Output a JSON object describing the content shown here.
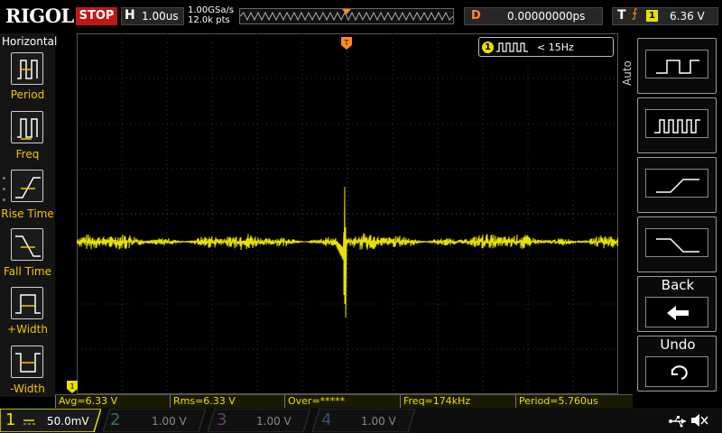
{
  "brand": "RIGOL",
  "run_state": "STOP",
  "horizontal": {
    "label": "H",
    "timebase": "1.00us",
    "sample_rate": "1.00GSa/s",
    "points": "12.0k pts"
  },
  "delay": {
    "label": "D",
    "value": "0.00000000ps"
  },
  "trigger": {
    "label": "T",
    "channel": "1",
    "level": "6.36 V",
    "marker": "T"
  },
  "freq_counter": {
    "channel": "1",
    "value": "< 15Hz"
  },
  "left_menu": {
    "title": "Horizontal",
    "items": [
      {
        "label": "Period"
      },
      {
        "label": "Freq"
      },
      {
        "label": "Rise Time"
      },
      {
        "label": "Fall Time"
      },
      {
        "label": "+Width"
      },
      {
        "label": "-Width"
      }
    ]
  },
  "right_menu": {
    "auto_label": "Auto",
    "back_label": "Back",
    "undo_label": "Undo"
  },
  "measurements": [
    {
      "text": "Avg=6.33 V"
    },
    {
      "text": "Rms=6.33 V"
    },
    {
      "text": "Over=*****"
    },
    {
      "text": "Freq=174kHz"
    },
    {
      "text": "Period=5.760us"
    }
  ],
  "channels": [
    {
      "num": "1",
      "scale": "50.0mV",
      "color": "#e8e000"
    },
    {
      "num": "2",
      "scale": "1.00 V",
      "color": "#00c8c8"
    },
    {
      "num": "3",
      "scale": "1.00 V",
      "color": "#e040e0"
    },
    {
      "num": "4",
      "scale": "1.00 V",
      "color": "#4080ff"
    }
  ],
  "colors": {
    "ch1": "#e8e000",
    "trigger": "#ff8c1a",
    "stop": "#c01818"
  }
}
